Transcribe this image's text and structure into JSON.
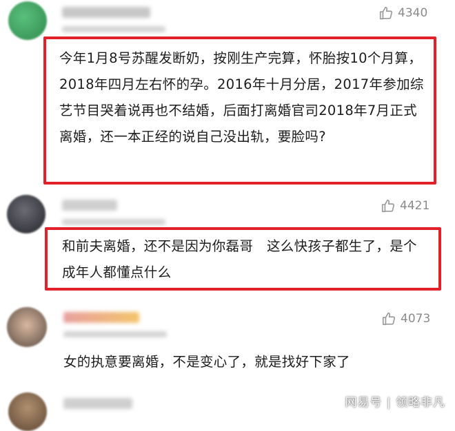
{
  "comments": [
    {
      "likes": "4340",
      "text": "今年1月8号苏醒发断奶，按刚生产完算，怀胎按10个月算，2018年四月左右怀的孕。2016年十月分居，2017年参加综艺节目哭着说再也不结婚，后面打离婚官司2018年7月正式离婚，还一本正经的说自己没出轨，要脸吗?",
      "avatar_color": "#3a9a5c"
    },
    {
      "likes": "4421",
      "text": "和前夫离婚，还不是因为你磊哥　这么快孩子都生了，是个成年人都懂点什么",
      "avatar_color": "#3c3c44"
    },
    {
      "likes": "4073",
      "text": "女的执意要离婚，不是变心了，就是找好下家了",
      "avatar_color": "#7a6658"
    },
    {
      "avatar_color": "#8c6f55"
    }
  ],
  "watermark": "网易号 | 领略非凡",
  "colors": {
    "highlight": "#e3202a",
    "like_icon": "#9a9a9a"
  },
  "icons": {
    "like": "thumbs-up-icon"
  }
}
